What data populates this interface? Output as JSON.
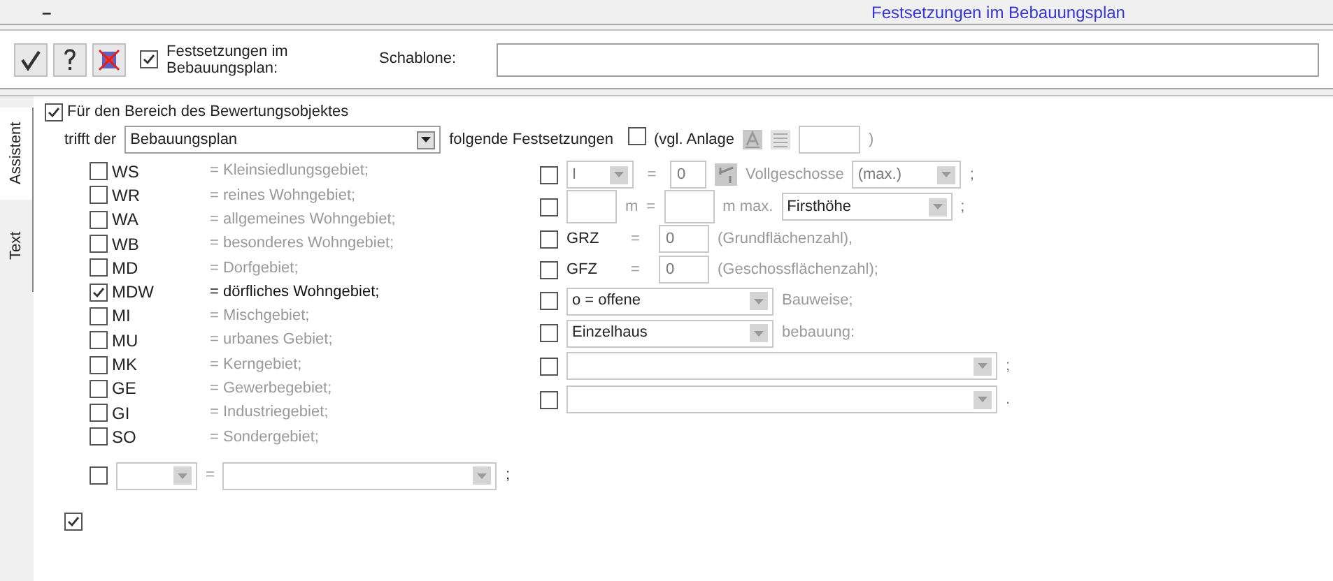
{
  "header": {
    "collapse": "–",
    "title": "Festsetzungen im Bebauungsplan"
  },
  "toolbar": {
    "buttons": [
      {
        "kind": "check"
      },
      {
        "kind": "help"
      },
      {
        "kind": "delete"
      }
    ],
    "checkbox": {
      "label": "Festsetzungen im Bebauungsplan:",
      "checked": true
    },
    "template_label": "Schablone:"
  },
  "side_tabs": [
    {
      "label": "Assistent",
      "selected": true
    },
    {
      "label": "Text",
      "selected": false
    }
  ],
  "scope": {
    "label": "Für den Bereich des Bewertungsobjektes",
    "checked": true
  },
  "plan_row": {
    "prefix": "trifft der",
    "select": "Bebauungsplan",
    "suffix": "folgende Festsetzungen",
    "annex_checked": false,
    "annex_label": "(vgl. Anlage",
    "annex_close": ")"
  },
  "zones": [
    {
      "code": "WS",
      "description": "= Kleinsiedlungsgebiet;",
      "checked": false
    },
    {
      "code": "WR",
      "description": "= reines Wohngebiet;",
      "checked": false
    },
    {
      "code": "WA",
      "description": "= allgemeines Wohngebiet;",
      "checked": false
    },
    {
      "code": "WB",
      "description": "= besonderes Wohngebiet;",
      "checked": false
    },
    {
      "code": "MD",
      "description": "= Dorfgebiet;",
      "checked": false
    },
    {
      "code": "MDW",
      "description": "= dörfliches Wohngebiet;",
      "checked": true
    },
    {
      "code": "MI",
      "description": "= Mischgebiet;",
      "checked": false
    },
    {
      "code": "MU",
      "description": "= urbanes Gebiet;",
      "checked": false
    },
    {
      "code": "MK",
      "description": "= Kerngebiet;",
      "checked": false
    },
    {
      "code": "GE",
      "description": "= Gewerbegebiet;",
      "checked": false
    },
    {
      "code": "GI",
      "description": "= Industriegebiet;",
      "checked": false
    },
    {
      "code": "SO",
      "description": "= Sondergebiet;",
      "checked": false
    }
  ],
  "custom_zone": {
    "checked": false,
    "eq": "=",
    "end": ";"
  },
  "settings": [
    {
      "kind": "storeys",
      "checked": false,
      "select": "I",
      "eq": "=",
      "value": "0",
      "label": "Vollgeschosse",
      "select2": "(max.)",
      "end": ";"
    },
    {
      "kind": "height",
      "checked": false,
      "unit": "m",
      "eq": "=",
      "unit2": "m max.",
      "select": "Firsthöhe",
      "end": ";"
    },
    {
      "kind": "ratio",
      "checked": false,
      "code": "GRZ",
      "eq": "=",
      "value": "0",
      "label": "(Grundflächenzahl),"
    },
    {
      "kind": "ratio",
      "checked": false,
      "code": "GFZ",
      "eq": "=",
      "value": "0",
      "label": "(Geschossflächenzahl);"
    },
    {
      "kind": "select",
      "checked": false,
      "select": "o = offene",
      "label": "Bauweise;"
    },
    {
      "kind": "select",
      "checked": false,
      "select": "Einzelhaus",
      "label": "bebauung:"
    },
    {
      "kind": "wide",
      "checked": false,
      "end": ";"
    },
    {
      "kind": "wide",
      "checked": false,
      "end": "."
    }
  ],
  "footer_checkbox": {
    "checked": true
  }
}
